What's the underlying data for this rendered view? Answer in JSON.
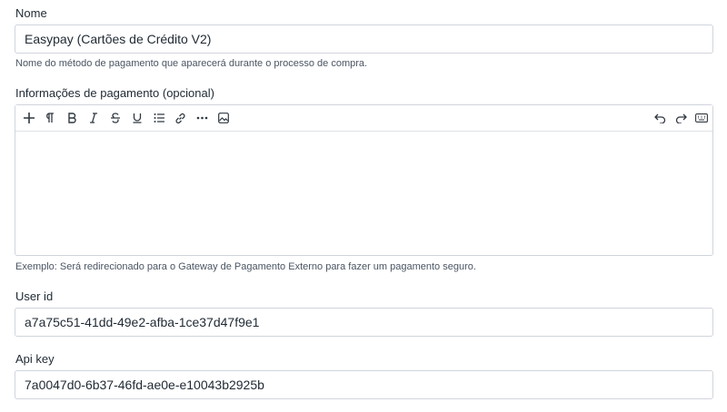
{
  "fields": {
    "name": {
      "label": "Nome",
      "value": "Easypay (Cartões de Crédito V2)",
      "help": "Nome do método de pagamento que aparecerá durante o processo de compra."
    },
    "payment_info": {
      "label": "Informações de pagamento (opcional)",
      "value": "",
      "help": "Exemplo: Será redirecionado para o Gateway de Pagamento Externo para fazer um pagamento seguro.",
      "toolbar": [
        "plus-icon",
        "paragraph-icon",
        "bold-icon",
        "italic-icon",
        "strikethrough-icon",
        "underline-icon",
        "bullet-list-icon",
        "link-icon",
        "more-icon",
        "image-icon",
        "undo-icon",
        "redo-icon",
        "keyboard-icon"
      ]
    },
    "user_id": {
      "label": "User id",
      "value": "a7a75c51-41dd-49e2-afba-1ce37d47f9e1"
    },
    "api_key": {
      "label": "Api key",
      "value": "7a0047d0-6b37-46fd-ae0e-e10043b2925b"
    }
  }
}
